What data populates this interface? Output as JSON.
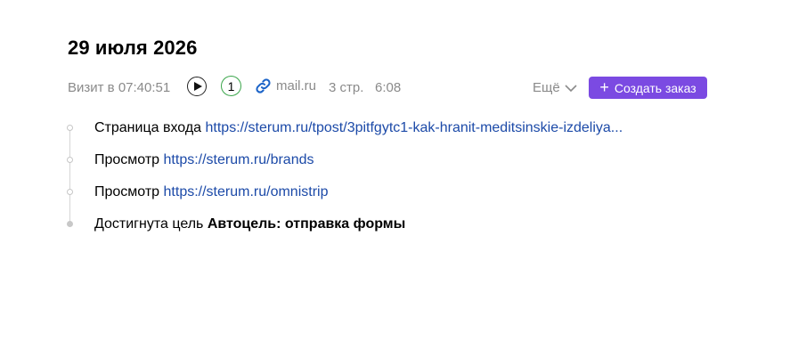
{
  "visit": {
    "date": "29 июля 2026",
    "visit_time": "Визит в 07:40:51",
    "goals_count": "1",
    "source": "mail.ru",
    "pages": "3 стр.",
    "duration": "6:08",
    "more_label": "Ещё",
    "create_order_label": "Создать заказ"
  },
  "events": [
    {
      "label": "Страница входа",
      "link": "https://sterum.ru/tpost/3pitfgytc1-kak-hranit-meditsinskie-izdeliya..."
    },
    {
      "label": "Просмотр",
      "link": "https://sterum.ru/brands"
    },
    {
      "label": "Просмотр",
      "link": "https://sterum.ru/omnistrip"
    },
    {
      "label": "Достигнута цель",
      "goal": "Автоцель: отправка формы"
    }
  ],
  "colors": {
    "accent": "#7b4ae2",
    "link": "#1c4aa8",
    "goal_ring": "#3aa54a",
    "muted": "#8a8a8a"
  },
  "icons": {
    "play": "play-icon",
    "source": "link-icon",
    "more": "chevron-down-icon",
    "create": "plus-icon"
  }
}
